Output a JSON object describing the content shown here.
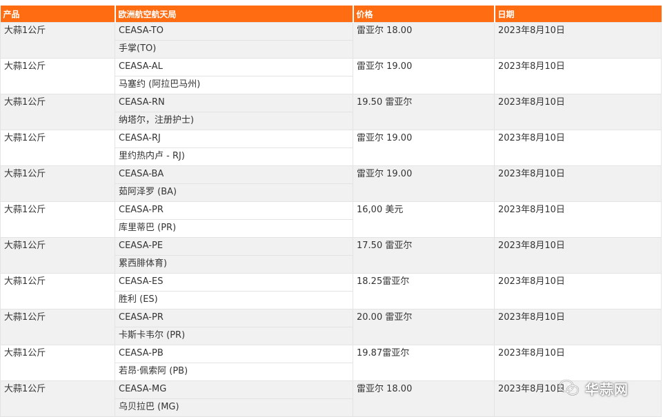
{
  "table": {
    "headers": [
      "产品",
      "欧洲航空航天局",
      "价格",
      "日期"
    ],
    "rows": [
      {
        "product": "大蒜1公斤",
        "ceasa": "CEASA-TO",
        "location": "手掌(TO)",
        "price": "雷亚尔 18.00",
        "date": "2023年8月10日"
      },
      {
        "product": "大蒜1公斤",
        "ceasa": "CEASA-AL",
        "location": "马塞约 (阿拉巴马州)",
        "price": "雷亚尔 19.00",
        "date": "2023年8月10日"
      },
      {
        "product": "大蒜1公斤",
        "ceasa": "CEASA-RN",
        "location": "纳塔尔，注册护士)",
        "price": "19.50 雷亚尔",
        "date": "2023年8月10日"
      },
      {
        "product": "大蒜1公斤",
        "ceasa": "CEASA-RJ",
        "location": "里约热内卢 - RJ)",
        "price": "雷亚尔 19.00",
        "date": "2023年8月10日"
      },
      {
        "product": "大蒜1公斤",
        "ceasa": "CEASA-BA",
        "location": "茹阿泽罗 (BA)",
        "price": "雷亚尔 19.00",
        "date": "2023年8月10日"
      },
      {
        "product": "大蒜1公斤",
        "ceasa": "CEASA-PR",
        "location": "库里蒂巴 (PR)",
        "price": "16,00 美元",
        "date": "2023年8月10日"
      },
      {
        "product": "大蒜1公斤",
        "ceasa": "CEASA-PE",
        "location": "累西腓体育)",
        "price": "17.50 雷亚尔",
        "date": "2023年8月10日"
      },
      {
        "product": "大蒜1公斤",
        "ceasa": "CEASA-ES",
        "location": "胜利 (ES)",
        "price": "18.25雷亚尔",
        "date": "2023年8月10日"
      },
      {
        "product": "大蒜1公斤",
        "ceasa": "CEASA-PR",
        "location": "卡斯卡韦尔 (PR)",
        "price": "20.00 雷亚尔",
        "date": "2023年8月10日"
      },
      {
        "product": "大蒜1公斤",
        "ceasa": "CEASA-PB",
        "location": "若昂·佩索阿 (PB)",
        "price": "19.87雷亚尔",
        "date": "2023年8月10日"
      },
      {
        "product": "大蒜1公斤",
        "ceasa": "CEASA-MG",
        "location": "乌贝拉巴 (MG)",
        "price": "雷亚尔 18.00",
        "date": "2023年8月10日"
      }
    ]
  },
  "watermark": {
    "text": "华蒜网",
    "icon": "wechat-icon"
  },
  "colors": {
    "header_bg": "#ff6c12",
    "header_text": "#ffffff",
    "row_alt_bg": "#f1f1f1",
    "grid_line": "#e3e3e3"
  }
}
